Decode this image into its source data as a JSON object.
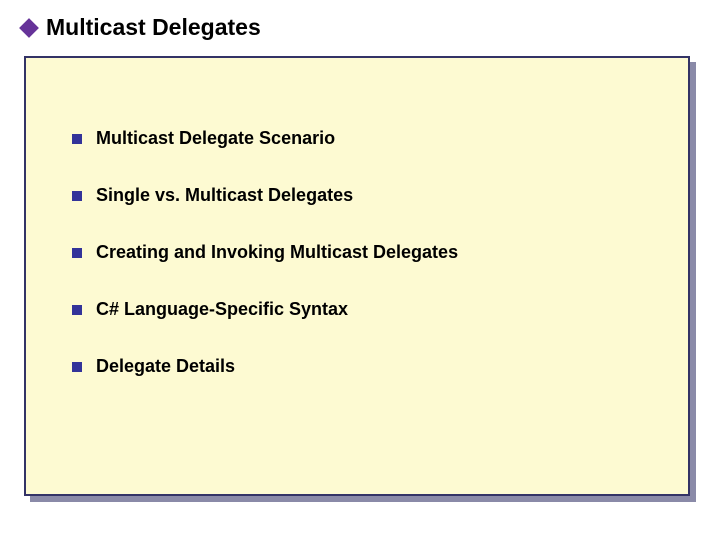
{
  "title": "Multicast Delegates",
  "bullets": [
    {
      "text": "Multicast Delegate Scenario"
    },
    {
      "text": "Single vs. Multicast Delegates"
    },
    {
      "text": "Creating and Invoking Multicast Delegates"
    },
    {
      "text": "C# Language-Specific Syntax"
    },
    {
      "text": "Delegate Details"
    }
  ],
  "colors": {
    "title_bullet": "#663399",
    "item_bullet": "#333399",
    "panel_bg": "#fdfad2",
    "panel_border": "#333366",
    "panel_shadow": "#8a8aa8"
  }
}
